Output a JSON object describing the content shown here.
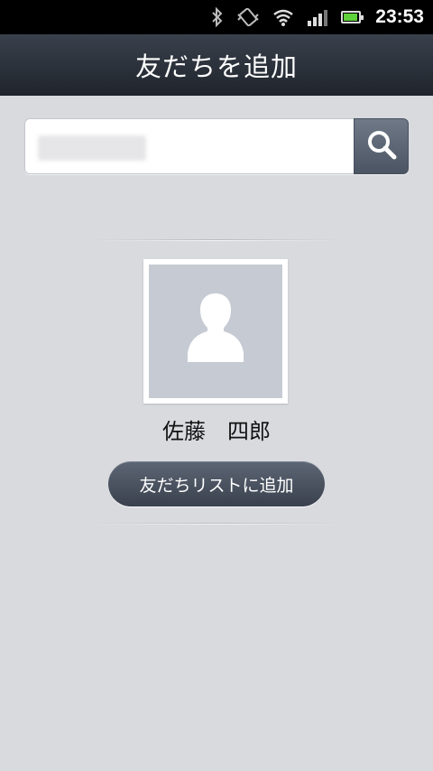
{
  "status_bar": {
    "time": "23:53",
    "icons": [
      "bluetooth-icon",
      "vibrate-icon",
      "wifi-icon",
      "signal-icon",
      "battery-icon"
    ],
    "battery_level": 0.9
  },
  "header": {
    "title": "友だちを追加"
  },
  "search": {
    "value": "",
    "icon": "search-icon"
  },
  "profile": {
    "name": "佐藤　四郎",
    "avatar_icon": "default-person-icon"
  },
  "actions": {
    "add_to_friends_label": "友だちリストに追加"
  },
  "colors": {
    "background": "#d8dade",
    "titlebar": "#2b313a",
    "button": "#4b5462",
    "battery_fill": "#5fd13a"
  }
}
